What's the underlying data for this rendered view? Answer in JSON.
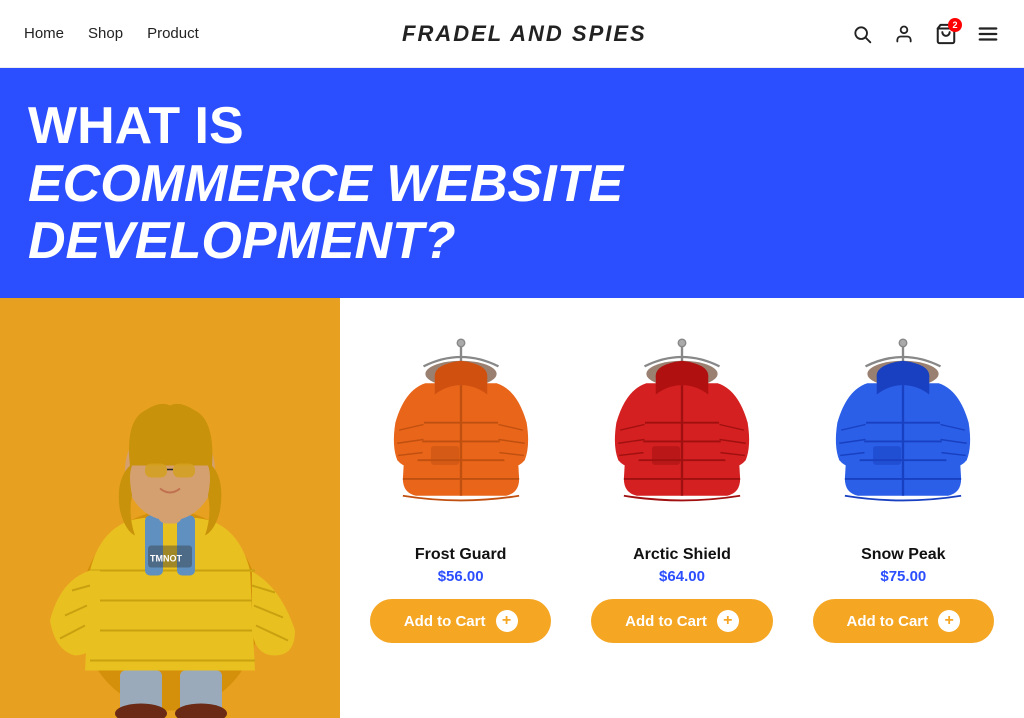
{
  "header": {
    "nav": [
      {
        "label": "Home",
        "href": "#"
      },
      {
        "label": "Shop",
        "href": "#"
      },
      {
        "label": "Product",
        "href": "#"
      }
    ],
    "logo": "FRADEL AND SPIES",
    "cart_count": "2",
    "icons": {
      "search": "🔍",
      "account": "👤",
      "cart": "🛍",
      "menu": "☰"
    }
  },
  "hero": {
    "what_is": "WHAT IS",
    "subtitle": "ECOMMERCE WEBSITE DEVELOPMENT?"
  },
  "products": [
    {
      "name": "Frost Guard",
      "price": "$56.00",
      "color": "orange",
      "add_to_cart": "Add to Cart"
    },
    {
      "name": "Arctic Shield",
      "price": "$64.00",
      "color": "red",
      "add_to_cart": "Add to Cart"
    },
    {
      "name": "Snow Peak",
      "price": "$75.00",
      "color": "blue",
      "add_to_cart": "Add to Cart"
    }
  ]
}
